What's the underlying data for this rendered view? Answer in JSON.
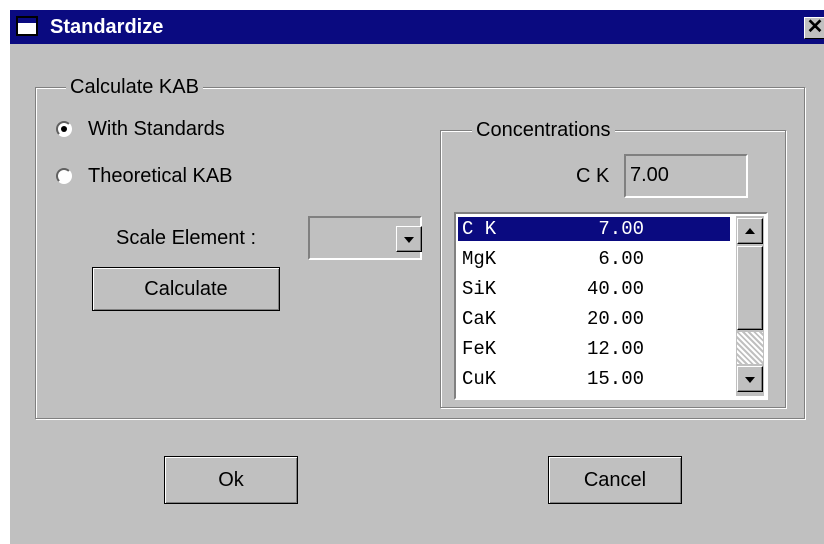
{
  "window": {
    "title": "Standardize",
    "close_glyph": "✕"
  },
  "calculate_group": {
    "legend": "Calculate KAB",
    "radio_standards": {
      "label": "With Standards",
      "checked": true
    },
    "radio_theoretical": {
      "label": "Theoretical KAB",
      "checked": false
    },
    "scale_element": {
      "label": "Scale Element :",
      "value": ""
    },
    "calculate_button": "Calculate"
  },
  "concentrations_group": {
    "legend": "Concentrations",
    "current_label": "C K",
    "current_value": "7.00",
    "items": [
      {
        "element": "C K",
        "value": "7.00",
        "selected": true
      },
      {
        "element": "MgK",
        "value": "6.00",
        "selected": false
      },
      {
        "element": "SiK",
        "value": "40.00",
        "selected": false
      },
      {
        "element": "CaK",
        "value": "20.00",
        "selected": false
      },
      {
        "element": "FeK",
        "value": "12.00",
        "selected": false
      },
      {
        "element": "CuK",
        "value": "15.00",
        "selected": false
      }
    ]
  },
  "buttons": {
    "ok": "Ok",
    "cancel": "Cancel"
  },
  "icons": {
    "app": "window-icon",
    "close": "close-icon",
    "dropdown": "chevron-down-icon",
    "scroll_up": "arrow-up-icon",
    "scroll_down": "arrow-down-icon"
  },
  "colors": {
    "titlebar": "#0a0a80",
    "face": "#c0c0c0",
    "selection": "#0a0a80"
  }
}
